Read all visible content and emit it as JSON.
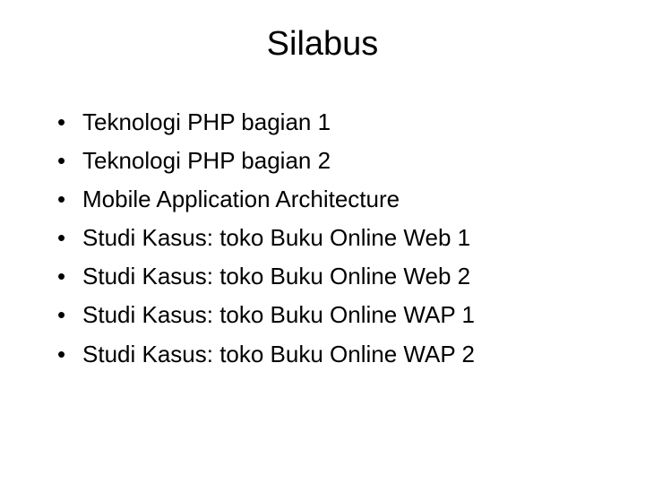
{
  "title": "Silabus",
  "items": [
    "Teknologi PHP bagian 1",
    "Teknologi PHP bagian 2",
    "Mobile Application Architecture",
    "Studi Kasus: toko Buku Online Web 1",
    "Studi Kasus: toko Buku Online Web 2",
    "Studi Kasus: toko Buku Online WAP 1",
    "Studi Kasus: toko Buku Online WAP 2"
  ]
}
